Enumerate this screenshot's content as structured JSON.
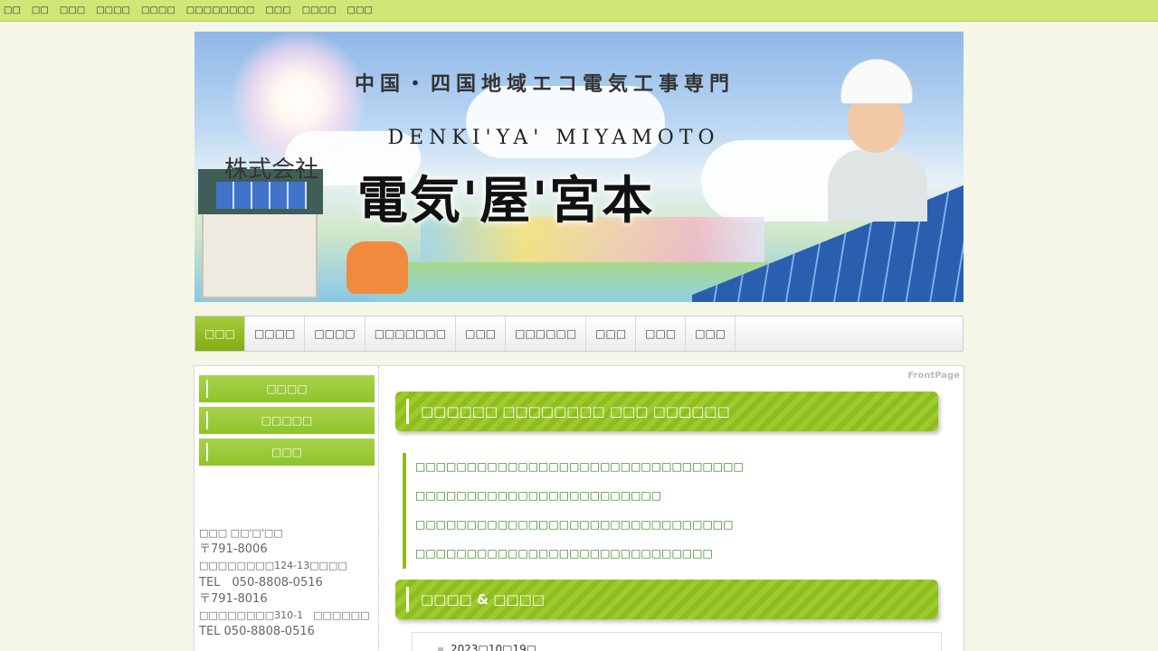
{
  "topbar": {
    "links": [
      "□□",
      "□□",
      "□□□",
      "□□□□",
      "□□□□",
      "□□□□□□□□",
      "□□□",
      "□□□□",
      "□□□"
    ]
  },
  "banner": {
    "tagline": "中国・四国地域エコ電気工事専門",
    "roman": "DENKI'YA' MIYAMOTO",
    "kabushiki": "株式会社",
    "company": "電気'屋'宮本"
  },
  "nav": {
    "items": [
      "□□□",
      "□□□□",
      "□□□□",
      "□□□□□□□",
      "□□□",
      "□□□□□□",
      "□□□",
      "□□□",
      "□□□"
    ],
    "active_index": 0
  },
  "sidebar": {
    "buttons": [
      "□□□□",
      "□□□□□",
      "□□□"
    ],
    "address": {
      "company": "□□□ □□'□'□□",
      "zip1": "〒791-8006",
      "addr1": "□□□□□□□□124-13□□□□",
      "tel1": "TEL　050-8808-0516",
      "zip2": "〒791-8016",
      "addr2": "□□□□□□□□310-1　□□□□□□",
      "tel2": "TEL 050-8808-0516"
    }
  },
  "main": {
    "breadcrumb": "FrontPage",
    "heading1": "□□□□□□ □□□□□□□□ □□□ □□□□□□",
    "links": [
      "□□□□□□□□□□□□□□□□□□□□□□□□□□□□□□□□",
      "□□□□□□□□□□□□□□□□□□□□□□□□",
      "□□□□□□□□□□□□□□□□□□□□□□□□□□□□□□□",
      "□□□□□□□□□□□□□□□□□□□□□□□□□□□□□"
    ],
    "heading2": "□□□□ & □□□□",
    "news_date": "2023□10□19□"
  },
  "colors": {
    "topbar": "#cfe777",
    "accent_green": "#8dbd1e",
    "link_green": "#2e7d14",
    "background": "#f5f5e8"
  }
}
